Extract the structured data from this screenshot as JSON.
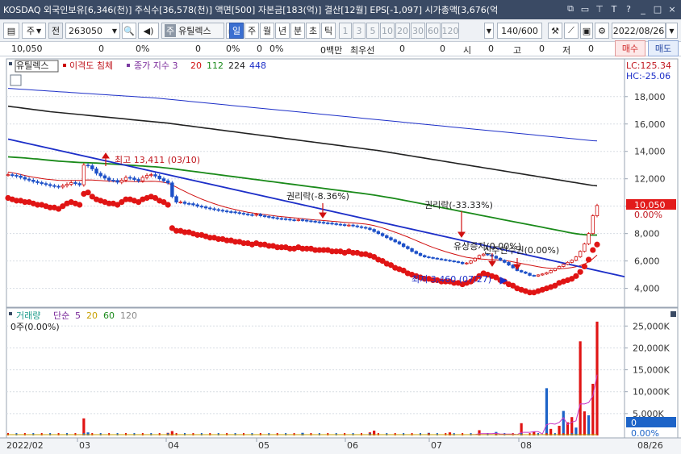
{
  "titlebar": {
    "text": "KOSDAQ 외국인보유[6,346(천)]  주식수[36,578(천)]  액면[500]  자본금[183(억)]  결산[12월]  EPS[-1,097]  시가총액[3,676(억",
    "icons": [
      "restore-icon",
      "copy-icon",
      "pin-icon",
      "text-icon",
      "help-icon",
      "minimize-icon",
      "maximize-icon",
      "close-icon"
    ]
  },
  "toolbar": {
    "period_type": "주",
    "code_label": "전",
    "code": "263050",
    "name": "유틸렉스",
    "prefix": "주",
    "periods": [
      "일",
      "주",
      "월",
      "년",
      "분",
      "초",
      "틱"
    ],
    "active_period": "일",
    "numbers": [
      "1",
      "3",
      "5",
      "10",
      "20",
      "30",
      "60",
      "120"
    ],
    "count": "140",
    "count_total": "/600",
    "date": "2022/08/26"
  },
  "inforow": {
    "price": "10,050",
    "v1": "0",
    "p1": "0%",
    "v2": "0",
    "p2": "0%",
    "v3": "0",
    "p3": "0%",
    "money": "0백만",
    "best_label": "최우선",
    "best_v1": "0",
    "best_v2": "0",
    "open_label": "시",
    "open_v": "0",
    "high_label": "고",
    "high_v": "0",
    "low_label": "저",
    "low_v": "0"
  },
  "actions": {
    "buy": "매수",
    "sell": "매도"
  },
  "chart_data": {
    "type": "line",
    "legend": {
      "name": "유틸렉스",
      "disparity": "이격도 침체",
      "ma_label": "종가 지수 3",
      "ma_periods": [
        "20",
        "112",
        "224",
        "448"
      ]
    },
    "lc": "LC:125.34",
    "hc": "HC:-25.06",
    "price_ticks": [
      "18,000",
      "16,000",
      "14,000",
      "12,000",
      "10,000",
      "8,000",
      "6,000",
      "4,000"
    ],
    "price_tick_values": [
      18000,
      16000,
      14000,
      12000,
      10000,
      8000,
      6000,
      4000
    ],
    "ylim": [
      2800,
      19400
    ],
    "current_price": "10,050",
    "current_change": "0.00%",
    "annotations": {
      "high": "최고 13,411 (03/10)",
      "low": "최저 3,460 (07/27)",
      "rights1": "권리락(-8.36%)",
      "rights2": "권리락(-33.33%)",
      "capital": "유상증자(0.00%)",
      "warrant": "신주인수권(0.00%)"
    },
    "x_labels": [
      "2022/02",
      "03",
      "04",
      "05",
      "06",
      "07",
      "08",
      "08/26"
    ],
    "closes": [
      12300,
      12250,
      12200,
      12100,
      11980,
      11900,
      11800,
      11720,
      11650,
      11580,
      11500,
      11450,
      11400,
      11500,
      11600,
      11720,
      11650,
      11560,
      13000,
      12950,
      12720,
      12400,
      12220,
      12050,
      11900,
      11880,
      11750,
      11900,
      12100,
      12050,
      11950,
      11850,
      12100,
      12250,
      12300,
      12200,
      12000,
      11850,
      11700,
      10700,
      10300,
      10300,
      10200,
      10180,
      10100,
      10000,
      9950,
      9870,
      9810,
      9750,
      9700,
      9650,
      9600,
      9580,
      9530,
      9480,
      9430,
      9380,
      9350,
      9400,
      9300,
      9250,
      9200,
      9150,
      9100,
      9080,
      9050,
      9000,
      8990,
      9010,
      8970,
      8930,
      8900,
      8860,
      8820,
      8780,
      8760,
      8720,
      8680,
      8650,
      8600,
      8620,
      8560,
      8500,
      8450,
      8400,
      8300,
      8150,
      8000,
      7850,
      7700,
      7550,
      7400,
      7250,
      7050,
      6900,
      6700,
      6550,
      6400,
      6300,
      6250,
      6200,
      6150,
      6100,
      6050,
      6000,
      5950,
      5900,
      5800,
      5850,
      6000,
      6200,
      6400,
      6500,
      6450,
      6350,
      6200,
      6050,
      5900,
      5700,
      5500,
      5300,
      5200,
      5100,
      4950,
      4900,
      4980,
      5050,
      5150,
      5300,
      5450,
      5600,
      5750,
      5900,
      6050,
      6300,
      6700,
      7250,
      8000,
      9300,
      10050
    ],
    "ma20": [
      12500,
      12440,
      12380,
      12310,
      12240,
      12180,
      12120,
      12070,
      12020,
      11980,
      11950,
      11920,
      11890,
      11880,
      11870,
      11880,
      11880,
      11880,
      11900,
      11920,
      11910,
      11890,
      11870,
      11850,
      11830,
      11810,
      11800,
      11800,
      11810,
      11810,
      11800,
      11790,
      11800,
      11810,
      11820,
      11810,
      11780,
      11740,
      11680,
      11550,
      11390,
      11230,
      11080,
      10930,
      10790,
      10650,
      10520,
      10400,
      10290,
      10180,
      10080,
      9990,
      9900,
      9820,
      9750,
      9680,
      9620,
      9560,
      9510,
      9470,
      9430,
      9390,
      9350,
      9310,
      9270,
      9240,
      9210,
      9180,
      9150,
      9120,
      9090,
      9060,
      9030,
      9000,
      8980,
      8950,
      8930,
      8900,
      8880,
      8850,
      8820,
      8800,
      8780,
      8750,
      8720,
      8690,
      8640,
      8580,
      8500,
      8410,
      8310,
      8210,
      8100,
      7990,
      7870,
      7750,
      7620,
      7490,
      7360,
      7230,
      7110,
      6990,
      6880,
      6780,
      6680,
      6590,
      6500,
      6420,
      6340,
      6270,
      6220,
      6180,
      6150,
      6130,
      6110,
      6100,
      6080,
      6060,
      6030,
      5990,
      5940,
      5880,
      5820,
      5760,
      5700,
      5640,
      5580,
      5530,
      5490,
      5460,
      5440,
      5440,
      5450,
      5480,
      5520,
      5580,
      5660,
      5780,
      5940,
      6160,
      6440
    ],
    "ma112": [
      13600,
      13580,
      13560,
      13540,
      13520,
      13490,
      13460,
      13440,
      13410,
      13380,
      13350,
      13320,
      13290,
      13270,
      13250,
      13230,
      13210,
      13190,
      13180,
      13170,
      13160,
      13150,
      13130,
      13110,
      13090,
      13070,
      13050,
      13030,
      13010,
      12990,
      12970,
      12950,
      12930,
      12910,
      12890,
      12870,
      12840,
      12810,
      12780,
      12740,
      12700,
      12660,
      12620,
      12580,
      12540,
      12500,
      12460,
      12420,
      12380,
      12340,
      12300,
      12260,
      12220,
      12180,
      12140,
      12100,
      12060,
      12020,
      11980,
      11940,
      11900,
      11860,
      11820,
      11780,
      11740,
      11700,
      11660,
      11620,
      11580,
      11540,
      11500,
      11460,
      11420,
      11380,
      11340,
      11300,
      11260,
      11220,
      11180,
      11140,
      11100,
      11060,
      11020,
      10980,
      10940,
      10900,
      10860,
      10810,
      10760,
      10710,
      10660,
      10610,
      10560,
      10500,
      10440,
      10380,
      10320,
      10260,
      10200,
      10140,
      10080,
      10020,
      9960,
      9900,
      9840,
      9780,
      9720,
      9660,
      9600,
      9540,
      9480,
      9420,
      9360,
      9300,
      9240,
      9180,
      9120,
      9060,
      9000,
      8940,
      8880,
      8820,
      8760,
      8700,
      8640,
      8580,
      8520,
      8460,
      8400,
      8340,
      8280,
      8220,
      8160,
      8100,
      8040,
      7990,
      7950,
      7920,
      7900,
      7890,
      7890
    ],
    "ma224": [
      17300,
      17260,
      17220,
      17180,
      17140,
      17100,
      17060,
      17020,
      16980,
      16940,
      16900,
      16870,
      16840,
      16810,
      16780,
      16750,
      16720,
      16690,
      16660,
      16630,
      16600,
      16570,
      16540,
      16510,
      16480,
      16450,
      16420,
      16390,
      16360,
      16330,
      16300,
      16270,
      16240,
      16210,
      16180,
      16150,
      16120,
      16090,
      16060,
      16020,
      15980,
      15940,
      15900,
      15860,
      15820,
      15780,
      15740,
      15700,
      15660,
      15620,
      15580,
      15540,
      15500,
      15460,
      15420,
      15380,
      15340,
      15300,
      15260,
      15220,
      15180,
      15140,
      15100,
      15060,
      15020,
      14980,
      14940,
      14900,
      14860,
      14820,
      14780,
      14740,
      14700,
      14660,
      14620,
      14580,
      14540,
      14500,
      14460,
      14420,
      14380,
      14340,
      14300,
      14260,
      14220,
      14180,
      14140,
      14100,
      14060,
      14010,
      13960,
      13910,
      13860,
      13810,
      13760,
      13710,
      13660,
      13610,
      13560,
      13510,
      13460,
      13410,
      13360,
      13310,
      13260,
      13210,
      13160,
      13110,
      13060,
      13010,
      12960,
      12910,
      12860,
      12810,
      12760,
      12710,
      12660,
      12610,
      12560,
      12510,
      12460,
      12410,
      12360,
      12310,
      12260,
      12210,
      12160,
      12110,
      12060,
      12010,
      11960,
      11910,
      11860,
      11810,
      11760,
      11710,
      11660,
      11610,
      11560,
      11510,
      11490
    ],
    "ma448": [
      18600,
      18580,
      18560,
      18540,
      18520,
      18500,
      18480,
      18460,
      18440,
      18420,
      18400,
      18380,
      18360,
      18340,
      18320,
      18300,
      18280,
      18260,
      18240,
      18220,
      18200,
      18180,
      18160,
      18140,
      18120,
      18100,
      18080,
      18060,
      18040,
      18020,
      18000,
      17980,
      17960,
      17940,
      17920,
      17900,
      17870,
      17840,
      17810,
      17780,
      17750,
      17720,
      17690,
      17660,
      17630,
      17600,
      17570,
      17540,
      17510,
      17480,
      17450,
      17420,
      17390,
      17360,
      17330,
      17300,
      17270,
      17240,
      17210,
      17180,
      17150,
      17120,
      17090,
      17060,
      17030,
      17000,
      16970,
      16940,
      16910,
      16880,
      16850,
      16820,
      16790,
      16760,
      16730,
      16700,
      16670,
      16640,
      16610,
      16580,
      16550,
      16520,
      16490,
      16460,
      16430,
      16400,
      16370,
      16340,
      16310,
      16280,
      16250,
      16220,
      16190,
      16160,
      16130,
      16100,
      16070,
      16040,
      16010,
      15980,
      15950,
      15920,
      15890,
      15860,
      15830,
      15800,
      15770,
      15740,
      15710,
      15680,
      15650,
      15620,
      15590,
      15560,
      15530,
      15500,
      15470,
      15440,
      15410,
      15380,
      15350,
      15320,
      15290,
      15260,
      15230,
      15200,
      15170,
      15140,
      15110,
      15080,
      15050,
      15020,
      14990,
      14960,
      14930,
      14900,
      14870,
      14840,
      14810,
      14780,
      14770
    ],
    "disparity": [
      10600,
      10500,
      10400,
      10400,
      10300,
      10300,
      10200,
      10100,
      10100,
      10000,
      9900,
      9900,
      9800,
      10000,
      10200,
      10300,
      10200,
      10100,
      10900,
      11000,
      10700,
      10500,
      10400,
      10300,
      10200,
      10200,
      10100,
      10300,
      10500,
      10500,
      10400,
      10300,
      10500,
      10600,
      10700,
      10600,
      10400,
      10300,
      10100,
      8400,
      8200,
      8200,
      8100,
      8100,
      8000,
      7900,
      7900,
      7800,
      7700,
      7700,
      7600,
      7600,
      7500,
      7500,
      7400,
      7400,
      7300,
      7300,
      7200,
      7300,
      7200,
      7200,
      7100,
      7100,
      7000,
      7000,
      7000,
      6900,
      6900,
      7000,
      6900,
      6900,
      6900,
      6800,
      6800,
      6800,
      6800,
      6700,
      6700,
      6700,
      6600,
      6700,
      6600,
      6600,
      6500,
      6500,
      6400,
      6300,
      6100,
      6000,
      5800,
      5700,
      5500,
      5400,
      5300,
      5100,
      5000,
      4900,
      4800,
      4700,
      4700,
      4600,
      4600,
      4500,
      4500,
      4500,
      4400,
      4400,
      4300,
      4400,
      4500,
      4700,
      4900,
      5100,
      5000,
      4900,
      4800,
      4600,
      4500,
      4300,
      4200,
      4000,
      3900,
      3800,
      3700,
      3700,
      3800,
      3900,
      4000,
      4100,
      4200,
      4400,
      4500,
      4600,
      4700,
      4900,
      5200,
      5600,
      6100,
      6800,
      7200
    ],
    "trendline": [
      {
        "x": 0,
        "y": 14900
      },
      {
        "x": 140,
        "y": 5300
      }
    ],
    "volume": {
      "title": "거래량",
      "ma_label": "단순",
      "ma_periods": [
        "5",
        "20",
        "60",
        "120"
      ],
      "value_text": "0주(0.00%)",
      "ticks": [
        "25,000K",
        "20,000K",
        "15,000K",
        "10,000K",
        "5,000K"
      ],
      "tick_values": [
        25000,
        20000,
        15000,
        10000,
        5000
      ],
      "ylim": [
        0,
        28000
      ],
      "current_value": "0",
      "current_change": "0.00%",
      "bars": [
        {
          "i": 18,
          "v": 3900
        },
        {
          "i": 19,
          "v": 700
        },
        {
          "i": 38,
          "v": 600
        },
        {
          "i": 39,
          "v": 1000
        },
        {
          "i": 70,
          "v": 600
        },
        {
          "i": 86,
          "v": 700
        },
        {
          "i": 87,
          "v": 1100
        },
        {
          "i": 100,
          "v": 600
        },
        {
          "i": 105,
          "v": 700
        },
        {
          "i": 112,
          "v": 1200
        },
        {
          "i": 116,
          "v": 800
        },
        {
          "i": 122,
          "v": 2800
        },
        {
          "i": 125,
          "v": 900
        },
        {
          "i": 128,
          "v": 10800
        },
        {
          "i": 129,
          "v": 1500
        },
        {
          "i": 131,
          "v": 2200
        },
        {
          "i": 132,
          "v": 5600
        },
        {
          "i": 133,
          "v": 3000
        },
        {
          "i": 134,
          "v": 4200
        },
        {
          "i": 135,
          "v": 1800
        },
        {
          "i": 136,
          "v": 21500
        },
        {
          "i": 137,
          "v": 5500
        },
        {
          "i": 138,
          "v": 4600
        },
        {
          "i": 139,
          "v": 11800
        },
        {
          "i": 140,
          "v": 26000
        }
      ]
    }
  }
}
